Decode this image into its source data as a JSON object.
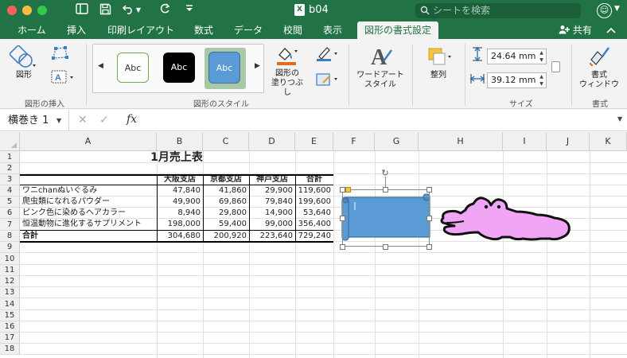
{
  "titlebar": {
    "doc_title": "b04",
    "search_placeholder": "シートを検索",
    "xl_glyph": "X"
  },
  "tabs": [
    {
      "label": "ホーム"
    },
    {
      "label": "挿入"
    },
    {
      "label": "印刷レイアウト"
    },
    {
      "label": "数式"
    },
    {
      "label": "データ"
    },
    {
      "label": "校閲"
    },
    {
      "label": "表示"
    },
    {
      "label": "図形の書式設定",
      "active": true
    }
  ],
  "share_label": "共有",
  "ribbon": {
    "shape_btn": "図形",
    "group_insert": "図形の挿入",
    "style_sample": "Abc",
    "fill_btn_line1": "図形の",
    "fill_btn_line2": "塗りつぶし",
    "group_style": "図形のスタイル",
    "wordart_line1": "ワードアート",
    "wordart_line2": "スタイル",
    "arrange_btn": "整列",
    "height_value": "24.64 mm",
    "width_value": "39.12 mm",
    "group_size": "サイズ",
    "format_pane_line1": "書式",
    "format_pane_line2": "ウィンドウ",
    "group_format": "書式"
  },
  "formula_bar": {
    "name_box": "横巻き 1",
    "fx_label": "fx",
    "formula": ""
  },
  "columns": [
    "A",
    "B",
    "C",
    "D",
    "E",
    "F",
    "G",
    "H",
    "I",
    "J",
    "K"
  ],
  "rows": [
    "1",
    "2",
    "3",
    "4",
    "5",
    "6",
    "7",
    "8",
    "9",
    "10",
    "11",
    "12",
    "13",
    "14",
    "15",
    "16",
    "17",
    "18"
  ],
  "sheet": {
    "title": "1月売上表",
    "headers": [
      "大阪支店",
      "京都支店",
      "神戸支店",
      "合計"
    ],
    "data": [
      {
        "name": "ワニchanぬいぐるみ",
        "values": [
          "47,840",
          "41,860",
          "29,900",
          "119,600"
        ]
      },
      {
        "name": "爬虫類になれるパウダー",
        "values": [
          "49,900",
          "69,860",
          "79,840",
          "199,600"
        ]
      },
      {
        "name": "ピンク色に染めるヘアカラー",
        "values": [
          "8,940",
          "29,800",
          "14,900",
          "53,640"
        ]
      },
      {
        "name": "恒温動物に進化するサプリメント",
        "values": [
          "198,000",
          "59,400",
          "99,000",
          "356,400"
        ]
      }
    ],
    "total": {
      "name": "合計",
      "values": [
        "304,680",
        "200,920",
        "223,640",
        "729,240"
      ]
    }
  },
  "colors": {
    "excel_green": "#217346",
    "scroll_fill": "#5b9bd5",
    "scroll_stroke": "#41719c",
    "croc_fill": "#f0a6f5"
  }
}
